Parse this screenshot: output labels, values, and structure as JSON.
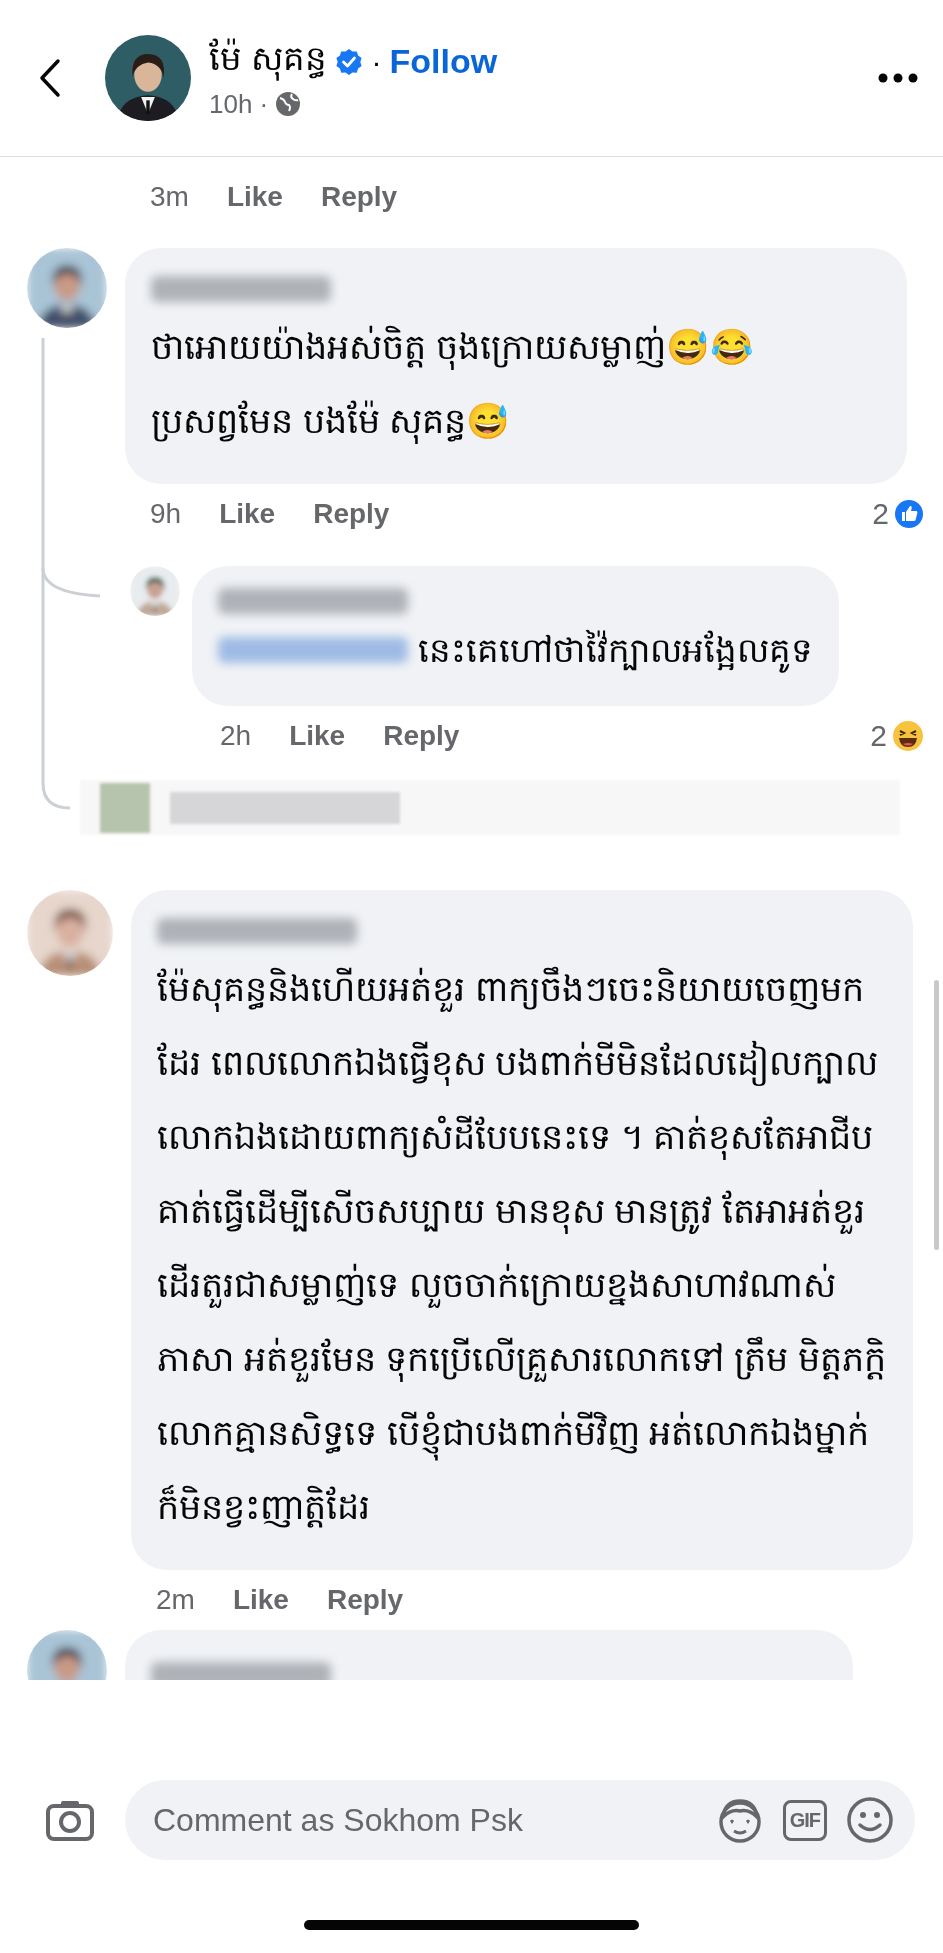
{
  "header": {
    "author": "ម៉ែ សុគន្ធ",
    "verified": true,
    "follow_separator": "·",
    "follow": "Follow",
    "time": "10h ·"
  },
  "previous_comment_actions": {
    "time": "3m",
    "like": "Like",
    "reply": "Reply"
  },
  "comments": [
    {
      "kind": "comment",
      "text": "ថាអោយយ៉ាងអស់ចិត្ត ចុងក្រោយសម្លាញ់😅😂 ប្រសព្វមែន បងម៉ែ សុគន្ធ😅",
      "time": "9h",
      "like": "Like",
      "reply": "Reply",
      "reaction": {
        "kind": "like",
        "count": "2"
      },
      "replies": [
        {
          "text": "នេះគេហៅថាវ៉ៃក្បាលអង្អែលគូទ",
          "time": "2h",
          "like": "Like",
          "reply": "Reply",
          "reaction": {
            "kind": "haha",
            "count": "2"
          }
        }
      ]
    },
    {
      "kind": "comment",
      "text": "ម៉ែសុគន្ធនិងហើយអត់ខួរ ពាក្យចឹងៗចេះនិយាយចេញមកដែរ ពេលលោកឯងធ្វើខុស បងពាក់មីមិនដែលដៀលក្បាលលោកឯងដោយពាក្យសំដីបែបនេះទេ ។ គាត់ខុសតែអាជីបគាត់ធ្វើដើម្បីសើចសប្បាយ មានខុស មានត្រូវ តែអាអត់ខួរដើរតួរជាសម្លាញ់ទេ លួចចាក់ក្រោយខ្នងសាហាវណាស់ ភាសា អត់ខួរមែន ទុកប្រើលើគ្រួសារលោកទៅ ត្រឹម មិត្តភក្តិ លោកគ្មានសិទ្ធទេ បើខ្ញុំជាបងពាក់មីវិញ អត់លោកឯងម្នាក់ក៏មិនខ្វះញាត្តិដែរ",
      "time": "2m",
      "like": "Like",
      "reply": "Reply"
    },
    {
      "kind": "cut_off"
    }
  ],
  "composer": {
    "placeholder": "Comment as Sokhom Psk",
    "gif_label": "GIF"
  }
}
